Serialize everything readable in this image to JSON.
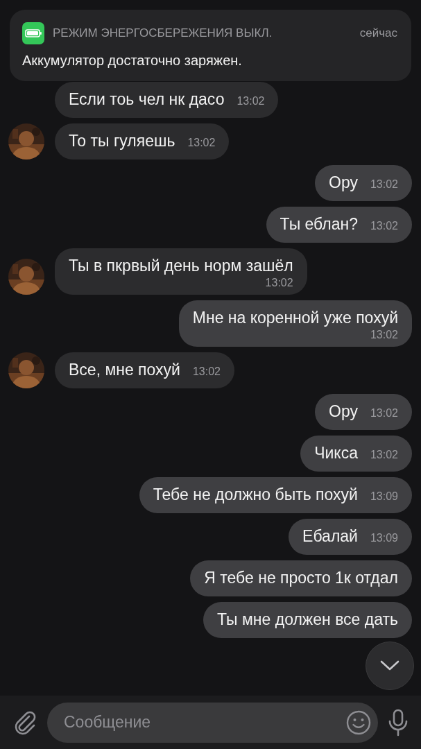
{
  "notification": {
    "title": "РЕЖИМ ЭНЕРГОСБЕРЕЖЕНИЯ ВЫКЛ.",
    "time": "сейчас",
    "body": "Аккумулятор достаточно заряжен."
  },
  "messages": [
    {
      "kind": "in",
      "avatar": false,
      "text": "Если тоь чел нк дасо",
      "time": "13:02",
      "time_below": false
    },
    {
      "kind": "in",
      "avatar": true,
      "text": "То ты гуляешь",
      "time": "13:02",
      "time_below": false
    },
    {
      "kind": "out",
      "text": "Ору",
      "time": "13:02",
      "time_below": false
    },
    {
      "kind": "out",
      "text": "Ты еблан?",
      "time": "13:02",
      "time_below": false
    },
    {
      "kind": "in",
      "avatar": true,
      "text": "Ты в пкрвый день норм зашёл",
      "time": "13:02",
      "time_below": true
    },
    {
      "kind": "out",
      "text": "Мне на коренной уже похуй",
      "time": "13:02",
      "time_below": true
    },
    {
      "kind": "in",
      "avatar": true,
      "text": "Все, мне похуй",
      "time": "13:02",
      "time_below": false
    },
    {
      "kind": "out",
      "text": "Ору",
      "time": "13:02",
      "time_below": false
    },
    {
      "kind": "out",
      "text": "Чикса",
      "time": "13:02",
      "time_below": false
    },
    {
      "kind": "out",
      "text": "Тебе не должно быть похуй",
      "time": "13:09",
      "time_below": false
    },
    {
      "kind": "out",
      "text": "Ебалай",
      "time": "13:09",
      "time_below": false
    },
    {
      "kind": "out",
      "text": "Я тебе не просто 1к отдал",
      "time_below": false
    },
    {
      "kind": "out",
      "text": "Ты мне должен все дать",
      "time_below": false
    }
  ],
  "composer": {
    "placeholder": "Сообщение"
  }
}
